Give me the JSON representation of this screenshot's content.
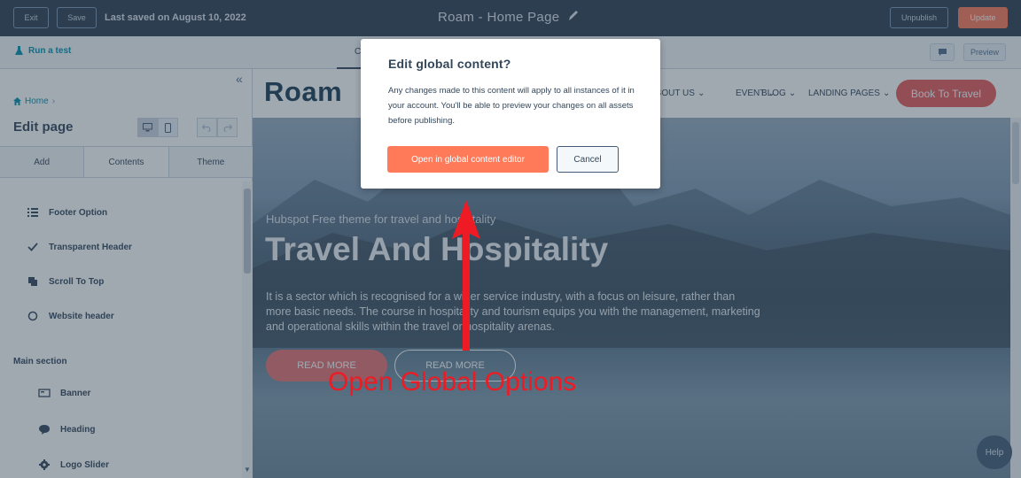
{
  "topbar": {
    "exit_label": "Exit",
    "save_label": "Save",
    "saved_status": "Last saved on August 10, 2022",
    "page_title": "Roam - Home Page",
    "unpublish_label": "Unpublish",
    "update_label": "Update"
  },
  "subbar": {
    "run_test_label": "Run a test",
    "tab_partial": "C",
    "preview_label": "Preview"
  },
  "sidebar": {
    "breadcrumb": "Home",
    "title": "Edit page",
    "tabs": [
      {
        "label": "Add"
      },
      {
        "label": "Contents"
      },
      {
        "label": "Theme"
      }
    ],
    "items": [
      {
        "label": "Footer Option",
        "icon": "list-icon"
      },
      {
        "label": "Transparent Header",
        "icon": "check-icon"
      },
      {
        "label": "Scroll To Top",
        "icon": "module-icon"
      },
      {
        "label": "Website header",
        "icon": "globe-icon"
      }
    ],
    "section_label": "Main section",
    "section_items": [
      {
        "label": "Banner",
        "icon": "banner-icon"
      },
      {
        "label": "Heading",
        "icon": "comment-icon"
      },
      {
        "label": "Logo Slider",
        "icon": "gear-icon"
      }
    ]
  },
  "site": {
    "logo": "Roam",
    "nav": [
      {
        "label": "ABOUT US"
      },
      {
        "label": "EVENT"
      },
      {
        "label": "BLOG"
      },
      {
        "label": "LANDING PAGES"
      }
    ],
    "book_label": "Book To Travel",
    "hero_subtitle": "Hubspot Free theme for travel and hospitality",
    "hero_title": "Travel And Hospitality",
    "hero_text": "It is a sector which is recognised for a wider service industry, with a focus on leisure, rather than more basic needs. The course in hospitality and tourism equips you with the management, marketing and operational skills within the travel or hospitality arenas.",
    "btn_primary": "READ MORE",
    "btn_secondary": "READ MORE",
    "help_label": "Help"
  },
  "modal": {
    "title": "Edit global content?",
    "body": "Any changes made to this content will apply to all instances of it in your account. You'll be able to preview your changes on all assets before publishing.",
    "primary_label": "Open in global content editor",
    "cancel_label": "Cancel"
  },
  "annotation": {
    "text": "Open Global Options",
    "color": "#ee1b24"
  },
  "colors": {
    "topbar": "#2d3e50",
    "accent": "#ff7a59",
    "link": "#0091ae",
    "book_button": "#e85a5a"
  }
}
